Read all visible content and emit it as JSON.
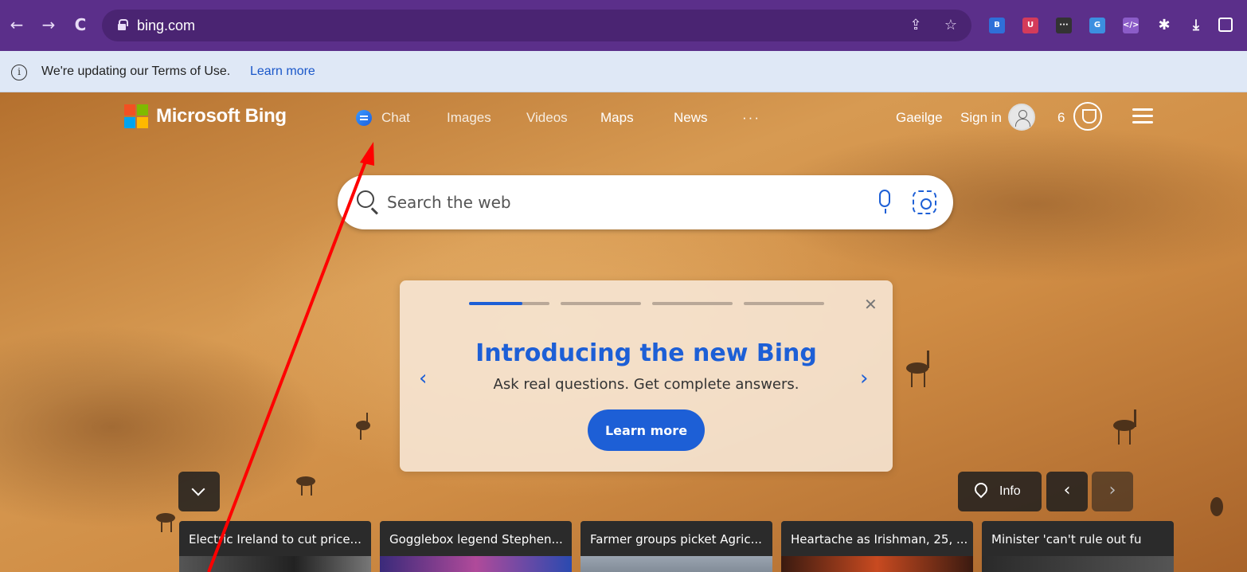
{
  "browser": {
    "url": "bing.com",
    "back_icon": "←",
    "forward_icon": "→",
    "reload_icon": "C"
  },
  "infobar": {
    "message": "We're updating our Terms of Use.",
    "link": "Learn more"
  },
  "bing": {
    "logo_text": "Microsoft Bing",
    "nav": [
      "Chat",
      "Images",
      "Videos",
      "Maps",
      "News",
      "···"
    ],
    "language": "Gaeilge",
    "sign_in": "Sign in",
    "rewards_count": "6",
    "search_placeholder": "Search the web",
    "promo": {
      "title": "Introducing the new Bing",
      "subtitle": "Ask real questions. Get complete answers.",
      "button": "Learn more",
      "active_slide": 1,
      "slides": 4,
      "progress": 0.66
    },
    "info_label": "Info",
    "news": [
      "Electric Ireland to cut price...",
      "Gogglebox legend Stephen...",
      "Farmer groups picket Agric...",
      "Heartache as Irishman, 25, ...",
      "Minister 'can't rule out fu"
    ]
  },
  "colors": {
    "chrome": "#5b2f8a",
    "accent": "#1d5fd6",
    "annotation_arrow": "#ff0000"
  }
}
